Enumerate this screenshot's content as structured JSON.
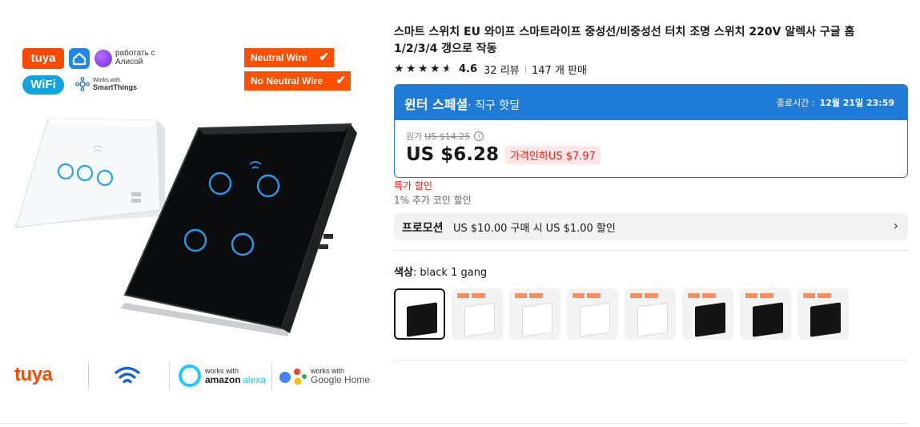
{
  "hero": {
    "logos": {
      "tuya_small": "tuya",
      "alice_text": "работать с Алисой",
      "wifi_small": "WiFi",
      "st_small": "Works with",
      "st_name": "SmartThings"
    },
    "badges": [
      "Neutral Wire",
      "No Neutral Wire"
    ],
    "partners": {
      "tuya": "tuya",
      "alexa_small": "works with",
      "alexa_brand": "amazon",
      "alexa_name": "alexa",
      "google_small": "works with",
      "google_name": "Google Home"
    }
  },
  "product": {
    "title": "스마트 스위치 EU 와이프 스마트라이프 중성선/비중성선 터치 조명 스위치 220V 알렉사 구글 홈 1/2/3/4 갱으로 작동",
    "rating": "4.6",
    "reviews": "32 리뷰",
    "sold": "147 개 판매",
    "stars": 4.6
  },
  "deal": {
    "name": "윈터 스페셜",
    "sub": "· 직구 핫딜",
    "end_label": "종료시간 :",
    "end_time": "12월 21일 23:59",
    "orig_label": "원가",
    "orig_price": "US $14.25",
    "price": "US $6.28",
    "drop": "가격인하US $7.97"
  },
  "labels": {
    "sale": "특가 할인",
    "coin": "1% 추가 코인 할인"
  },
  "promo": {
    "tag": "프로모션",
    "text": "US $10.00 구매 시 US $1.00 할인"
  },
  "color": {
    "label": "색상",
    "value": ": black 1 gang",
    "swatches": [
      "black",
      "white",
      "white",
      "white",
      "white",
      "black",
      "black",
      "black"
    ],
    "selected": 0
  },
  "colors": {
    "accent": "#1f7bd6",
    "brand_red": "#e62117",
    "badge_orange": "#ff4f00"
  }
}
